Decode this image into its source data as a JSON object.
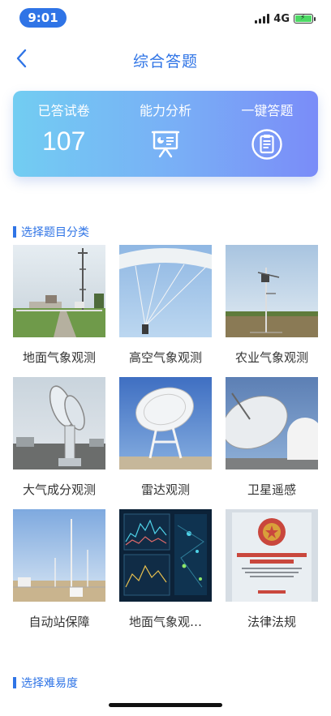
{
  "status_bar": {
    "time": "9:01",
    "network": "4G"
  },
  "header": {
    "title": "综合答题"
  },
  "stats": {
    "answered_label": "已答试卷",
    "answered_value": "107",
    "analysis_label": "能力分析",
    "quick_label": "一键答题"
  },
  "sections": {
    "category_title": "选择题目分类",
    "difficulty_title": "选择难易度"
  },
  "categories": [
    {
      "label": "地面气象观测",
      "image": "weather-station-photo"
    },
    {
      "label": "高空气象观测",
      "image": "weather-balloon-photo"
    },
    {
      "label": "农业气象观测",
      "image": "field-mast-photo"
    },
    {
      "label": "大气成分观测",
      "image": "antenna-tower-photo"
    },
    {
      "label": "雷达观测",
      "image": "radar-dish-photo"
    },
    {
      "label": "卫星遥感",
      "image": "satellite-dish-photo"
    },
    {
      "label": "自动站保障",
      "image": "desert-station-photo"
    },
    {
      "label": "地面气象观…",
      "image": "data-dashboard-photo"
    },
    {
      "label": "法律法规",
      "image": "regulation-book-photo"
    }
  ],
  "colors": {
    "accent": "#2f74e6",
    "card_start": "#72cdf2",
    "card_end": "#7a8cf8"
  }
}
